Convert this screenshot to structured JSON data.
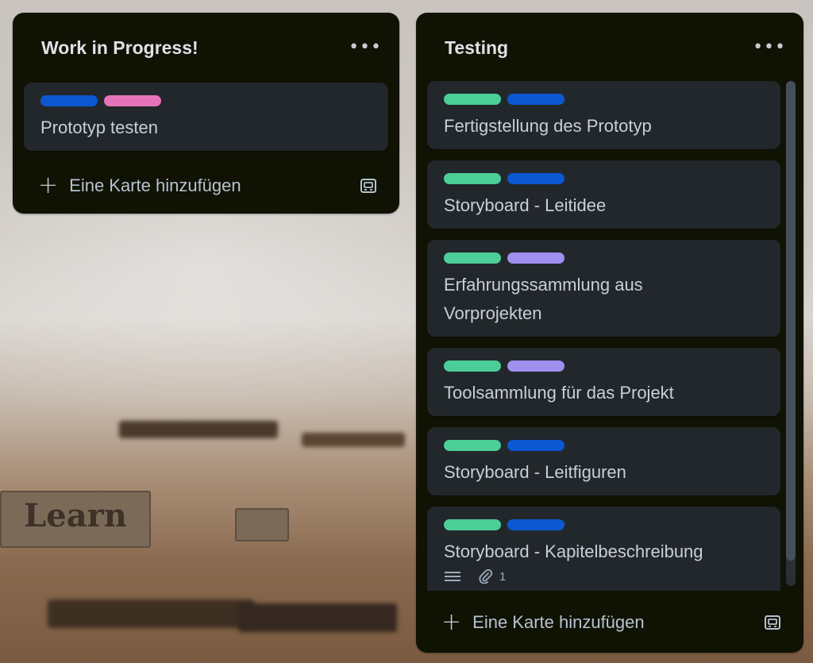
{
  "colors": {
    "label_blue": "#0c58d1",
    "label_pink": "#e774bb",
    "label_green": "#4bce97",
    "label_purple": "#9f8fef"
  },
  "lists": [
    {
      "title": "Work in Progress!",
      "more_icon": "ellipsis-icon",
      "cards": [
        {
          "title": "Prototyp testen",
          "labels": [
            "blue",
            "pink"
          ]
        }
      ],
      "add_card_label": "Eine Karte hinzufügen",
      "template_icon": "card-template-icon"
    },
    {
      "title": "Testing",
      "more_icon": "ellipsis-icon",
      "cards": [
        {
          "title": "Fertigstellung des Prototyp",
          "labels": [
            "green",
            "blue"
          ]
        },
        {
          "title": "Storyboard - Leitidee",
          "labels": [
            "green",
            "blue"
          ]
        },
        {
          "title": "Erfahrungssammlung aus Vorprojekten",
          "labels": [
            "green",
            "purple"
          ]
        },
        {
          "title": "Toolsammlung für das Projekt",
          "labels": [
            "green",
            "purple"
          ]
        },
        {
          "title": "Storyboard - Leitfiguren",
          "labels": [
            "green",
            "blue"
          ]
        },
        {
          "title": "Storyboard - Kapitelbeschreibung",
          "labels": [
            "green",
            "blue"
          ],
          "badges": {
            "description": "description-icon",
            "attachments": "1"
          }
        }
      ],
      "add_card_label": "Eine Karte hinzufügen",
      "template_icon": "card-template-icon"
    }
  ],
  "background": {
    "letters": "Learn"
  }
}
